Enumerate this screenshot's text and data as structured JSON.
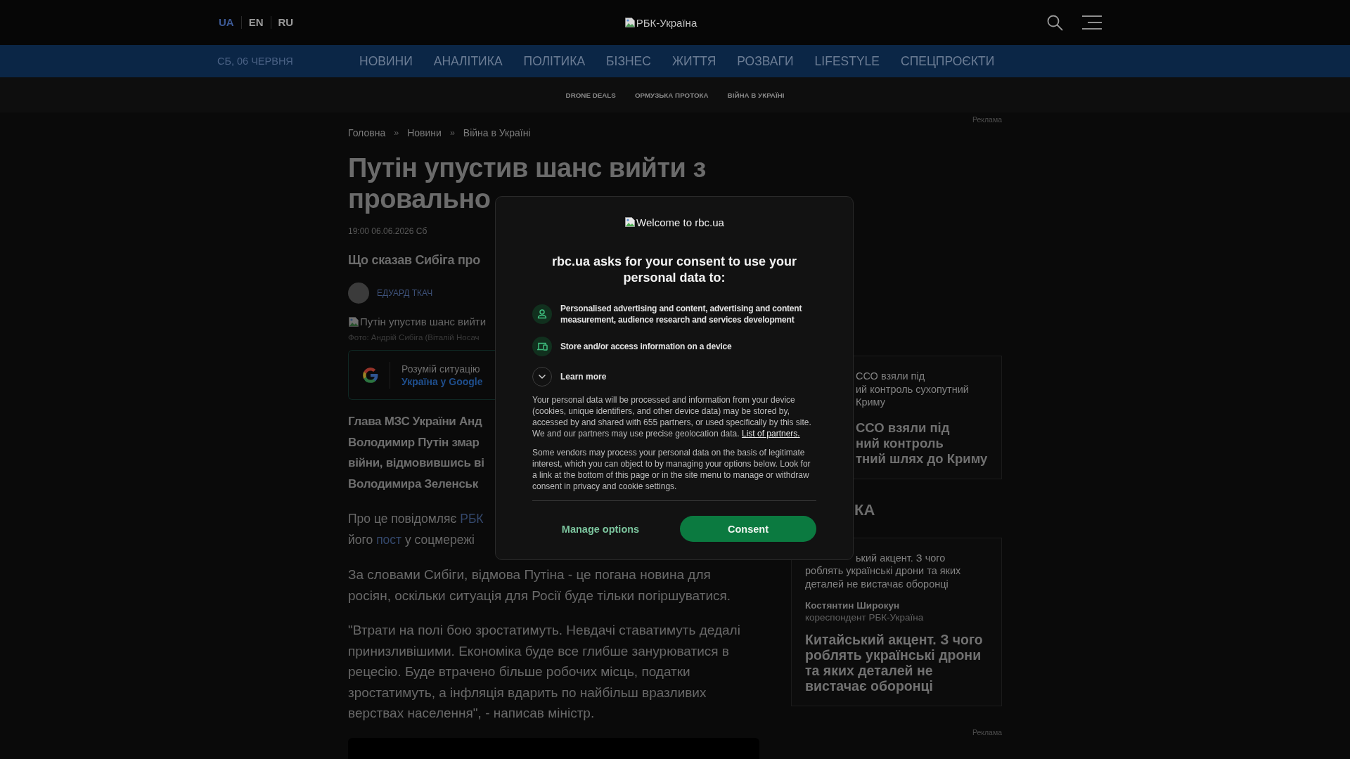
{
  "header": {
    "languages": [
      {
        "label": "UA",
        "selected": true
      },
      {
        "label": "EN",
        "selected": false
      },
      {
        "label": "RU",
        "selected": false
      }
    ],
    "logo_alt": "РБК-Україна"
  },
  "nav": {
    "date": "СБ, 06 ЧЕРВНЯ",
    "items": [
      "НОВИНИ",
      "АНАЛІТИКА",
      "ПОЛІТИКА",
      "БІЗНЕС",
      "ЖИТТЯ",
      "РОЗВАГИ",
      "LIFESTYLE",
      "СПЕЦПРОЄКТИ"
    ]
  },
  "subnav": {
    "items": [
      "DRONE DEALS",
      "ОРМУЗЬКА ПРОТОКА",
      "ВІЙНА В УКРАЇНІ"
    ]
  },
  "article": {
    "breadcrumbs": [
      {
        "kind": "link",
        "text": "Головна"
      },
      {
        "kind": "separator",
        "text": "»"
      },
      {
        "kind": "link",
        "text": "Новини"
      },
      {
        "kind": "separator",
        "text": "»"
      },
      {
        "kind": "link",
        "text": "Війна в Україні"
      }
    ],
    "title": "Путін упустив шанс вийти з провально",
    "published": "19:00 06.06.2026 Сб",
    "lead": "Що сказав Сибіга про",
    "author": "ЕДУАРД ТКАЧ",
    "image_alt": "Путін упустив шанс вийти",
    "photo_caption": "Фото: Андрій Сибіга (Віталій Носач",
    "google_promo": {
      "text": "Розумій ситуацію",
      "link": "Україна у Google"
    },
    "intro_lines": [
      "Глава МЗС України Анд",
      "Володимир Путін змар",
      "війни, відмовившись ві",
      "Володимира Зеленськ"
    ],
    "paragraphs": [
      {
        "kind": "cut_lines",
        "lines": [
          [
            {
              "kind": "text",
              "text": "Про це повідомляє"
            },
            {
              "kind": "link",
              "text": "РБК"
            }
          ],
          [
            {
              "kind": "text",
              "text": "його"
            },
            {
              "kind": "link",
              "text": "пост"
            },
            {
              "kind": "text",
              "text": "у соцмережі"
            }
          ]
        ]
      },
      {
        "kind": "text",
        "text": "За словами Сибіги, відмова Путіна - це погана новина для росіян, оскільки ситуація для Росії буде тільки погіршуватися."
      },
      {
        "kind": "text",
        "text": "\"Втрати на полі бою зростатимуть. Невдачі ставатимуть дедалі принизливішими. Економіка буде все глибше занурюватися в рецесію. Буде втрачено більше робочих місць, податки зростатимуть, а інфляція вдарить по найбільш вразливих верствах населення\", - написав міністр."
      }
    ]
  },
  "sidebar": {
    "top_ad_label": "Реклама",
    "news_card": {
      "caption_lines": [
        "ССО взяли під",
        "ий контроль сухопутний",
        "Криму"
      ],
      "title_lines": [
        "ССО взяли під",
        "ний контроль",
        "тний шлях до Криму"
      ]
    },
    "section_heading": "КА",
    "analytics_card": {
      "caption_first_line": "ький акцент. З чого",
      "caption_rest": "роблять українські дрони та яких деталей не вистачає оборонці",
      "author": "Костянтин Широкун",
      "author_role": "кореспондент РБК-Україна",
      "title": "Китайський акцент. З чого роблять українські дрони та яких деталей не вистачає оборонці"
    },
    "bottom_ad_label": "Реклама"
  },
  "consent_dialog": {
    "logo_alt": "Welcome to rbc.ua",
    "heading": "rbc.ua asks for your consent to use your personal data to:",
    "purposes": [
      {
        "kind": "person",
        "text": "Personalised advertising and content, advertising and content measurement, audience research and services development"
      },
      {
        "kind": "device",
        "text": "Store and/or access information on a device"
      }
    ],
    "learn_more": {
      "label": "Learn more",
      "expanded": false
    },
    "paragraphs": [
      {
        "text": "Your personal data will be processed and information from your device (cookies, unique identifiers, and other device data) may be stored by, accessed by and shared with 655 partners, or used specifically by this site. We and our partners may use precise geolocation data.",
        "link": "List of partners."
      },
      {
        "text": "Some vendors may process your personal data on the basis of legitimate interest, which you can object to by managing your options below. Look for a link at the bottom of this page or in the site menu to manage or withdraw consent in privacy and cookie settings."
      }
    ],
    "buttons": [
      {
        "kind": "secondary",
        "label": "Manage options"
      },
      {
        "kind": "primary",
        "label": "Consent"
      }
    ]
  }
}
